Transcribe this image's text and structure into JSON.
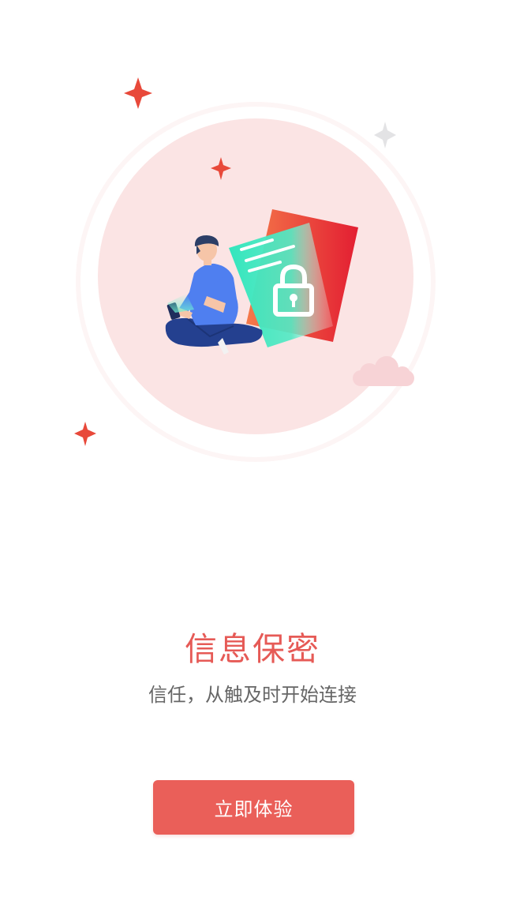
{
  "onboarding": {
    "title": "信息保密",
    "subtitle": "信任，从触及时开始连接",
    "cta_label": "立即体验"
  },
  "illustration": {
    "subject": "person-with-phone-and-locked-document",
    "icons": [
      "sparkle-icon",
      "padlock-icon",
      "cloud-icon"
    ]
  },
  "colors": {
    "accent": "#ea5f59",
    "title": "#e65a56",
    "subtitle": "#666666",
    "circle_fill": "#fbe4e4",
    "card_teal": "#3ee8c0",
    "card_red": "#e8323a",
    "shirt_blue": "#4f7ff0",
    "pants_navy": "#24408f"
  }
}
